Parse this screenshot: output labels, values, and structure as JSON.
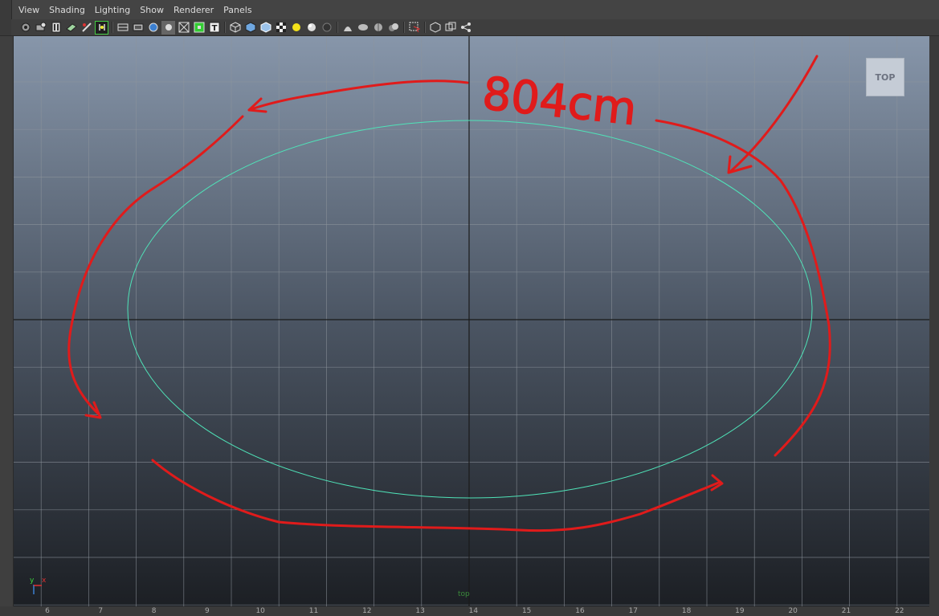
{
  "menu": [
    "View",
    "Shading",
    "Lighting",
    "Show",
    "Renderer",
    "Panels"
  ],
  "toolbar_icons": [
    "camera-select-icon",
    "camera-attributes-icon",
    "bookmarks-icon",
    "image-plane-icon",
    "grease-pencil-icon",
    "grid-icon",
    "film-gate-icon",
    "resolution-gate-icon",
    "gate-mask-icon",
    "field-chart-icon",
    "safe-action-icon",
    "safe-title-icon",
    "wireframe-icon",
    "smooth-shade-icon",
    "shaded-wireframe-icon",
    "textured-icon",
    "default-light-icon",
    "use-all-lights-icon",
    "shadows-icon",
    "screen-space-ao-icon",
    "motion-blur-icon",
    "multisample-aa-icon",
    "depth-of-field-icon",
    "isolate-select-icon",
    "xray-icon",
    "xray-active-components-icon",
    "xray-joints-icon"
  ],
  "viewport": {
    "view_cube_label": "TOP",
    "camera_name": "top",
    "axis_x": "x",
    "axis_y": "y",
    "grid_color": "#8d949c",
    "axis_line_color": "#1a1a1a",
    "curve_color": "#4fe3b8",
    "annotation_color": "#e01b1b",
    "annotation_text": "804cm"
  },
  "ruler_numbers": [
    "6",
    "7",
    "8",
    "9",
    "10",
    "11",
    "12",
    "13",
    "14",
    "15",
    "16",
    "17",
    "18",
    "19",
    "20",
    "21",
    "22"
  ]
}
